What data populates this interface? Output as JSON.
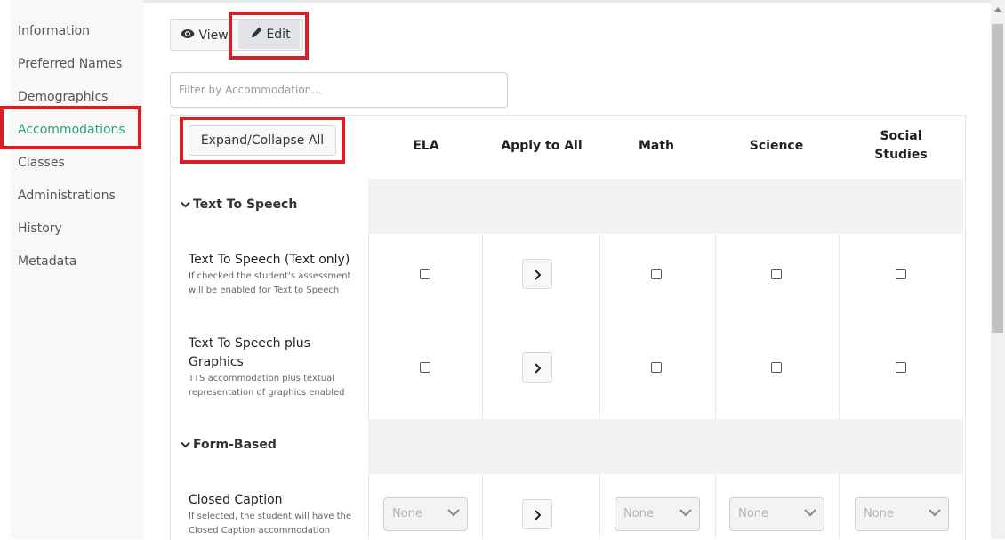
{
  "sidebar": {
    "items": [
      {
        "label": "Information"
      },
      {
        "label": "Preferred Names"
      },
      {
        "label": "Demographics"
      },
      {
        "label": "Accommodations",
        "active": true
      },
      {
        "label": "Classes"
      },
      {
        "label": "Administrations"
      },
      {
        "label": "History"
      },
      {
        "label": "Metadata"
      }
    ]
  },
  "toolbar": {
    "view_label": "View",
    "edit_label": "Edit"
  },
  "filter": {
    "placeholder": "Filter by Accommodation..."
  },
  "table": {
    "expand_label": "Expand/Collapse All",
    "columns": [
      "ELA",
      "Apply to All",
      "Math",
      "Science",
      "Social Studies"
    ],
    "groups": [
      {
        "label": "Text To Speech",
        "rows": [
          {
            "name": "Text To Speech (Text only)",
            "description": "If checked the student's assessment will be enabled for Text to Speech"
          },
          {
            "name": "Text To Speech plus Graphics",
            "description": "TTS accommodation plus textual representation of graphics enabled"
          }
        ]
      },
      {
        "label": "Form-Based",
        "rows": [
          {
            "name": "Closed Caption",
            "description": "If selected, the student will have the Closed Caption accommodation"
          }
        ]
      }
    ],
    "select_value": "None"
  },
  "colors": {
    "accent": "#2fa36b",
    "highlight": "#d91f26"
  }
}
